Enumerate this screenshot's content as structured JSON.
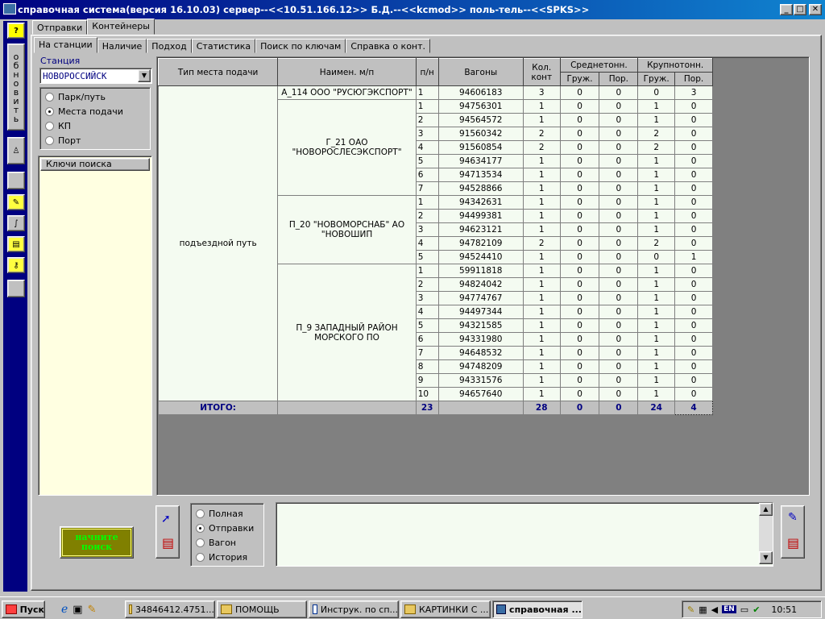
{
  "window": {
    "title": "справочная система(версия 16.10.03) сервер--<<10.51.166.12>> Б.Д.--<<kcmod>> поль-тель--<<SPKS>>"
  },
  "left_toolbar": {
    "refresh_label": "обновить",
    "help_label": "?"
  },
  "top_tabs": [
    "Отправки",
    "Контейнеры"
  ],
  "sub_tabs": [
    "На станции",
    "Наличие",
    "Подход",
    "Статистика",
    "Поиск по ключам",
    "Справка о конт."
  ],
  "station": {
    "label": "Станция",
    "value": "НОВОРОССИЙСК"
  },
  "mode_radios": [
    {
      "label": "Парк/путь",
      "selected": false
    },
    {
      "label": "Места подачи",
      "selected": true
    },
    {
      "label": "КП",
      "selected": false
    },
    {
      "label": "Порт",
      "selected": false
    }
  ],
  "keys_panel": {
    "header": "Ключи поиска"
  },
  "table": {
    "headers": {
      "type": "Тип места подачи",
      "name": "Наимен. м/п",
      "pn": "п/н",
      "wagons": "Вагоны",
      "kolkont": "Кол. конт",
      "medium": "Среднетонн.",
      "large": "Крупнотонн.",
      "gruzh": "Груж.",
      "por": "Пор."
    },
    "type_value": "подъездной путь",
    "groups": [
      {
        "name": "А_114 ООО \"РУСЮГЭКСПОРТ\"",
        "rows": [
          [
            "1",
            "94606183",
            "3",
            "0",
            "0",
            "0",
            "3"
          ]
        ]
      },
      {
        "name": "Г_21 ОАО \"НОВОРОСЛЕСЭКСПОРТ\"",
        "rows": [
          [
            "1",
            "94756301",
            "1",
            "0",
            "0",
            "1",
            "0"
          ],
          [
            "2",
            "94564572",
            "1",
            "0",
            "0",
            "1",
            "0"
          ],
          [
            "3",
            "91560342",
            "2",
            "0",
            "0",
            "2",
            "0"
          ],
          [
            "4",
            "91560854",
            "2",
            "0",
            "0",
            "2",
            "0"
          ],
          [
            "5",
            "94634177",
            "1",
            "0",
            "0",
            "1",
            "0"
          ],
          [
            "6",
            "94713534",
            "1",
            "0",
            "0",
            "1",
            "0"
          ],
          [
            "7",
            "94528866",
            "1",
            "0",
            "0",
            "1",
            "0"
          ]
        ]
      },
      {
        "name": "П_20 \"НОВОМОРСНАБ\" АО \"НОВОШИП",
        "rows": [
          [
            "1",
            "94342631",
            "1",
            "0",
            "0",
            "1",
            "0"
          ],
          [
            "2",
            "94499381",
            "1",
            "0",
            "0",
            "1",
            "0"
          ],
          [
            "3",
            "94623121",
            "1",
            "0",
            "0",
            "1",
            "0"
          ],
          [
            "4",
            "94782109",
            "2",
            "0",
            "0",
            "2",
            "0"
          ],
          [
            "5",
            "94524410",
            "1",
            "0",
            "0",
            "0",
            "1"
          ]
        ]
      },
      {
        "name": "П_9 ЗАПАДНЫЙ РАЙОН МОРСКОГО ПО",
        "rows": [
          [
            "1",
            "59911818",
            "1",
            "0",
            "0",
            "1",
            "0"
          ],
          [
            "2",
            "94824042",
            "1",
            "0",
            "0",
            "1",
            "0"
          ],
          [
            "3",
            "94774767",
            "1",
            "0",
            "0",
            "1",
            "0"
          ],
          [
            "4",
            "94497344",
            "1",
            "0",
            "0",
            "1",
            "0"
          ],
          [
            "5",
            "94321585",
            "1",
            "0",
            "0",
            "1",
            "0"
          ],
          [
            "6",
            "94331980",
            "1",
            "0",
            "0",
            "1",
            "0"
          ],
          [
            "7",
            "94648532",
            "1",
            "0",
            "0",
            "1",
            "0"
          ],
          [
            "8",
            "94748209",
            "1",
            "0",
            "0",
            "1",
            "0"
          ],
          [
            "9",
            "94331576",
            "1",
            "0",
            "0",
            "1",
            "0"
          ],
          [
            "10",
            "94657640",
            "1",
            "0",
            "0",
            "1",
            "0"
          ]
        ]
      }
    ],
    "total": {
      "label": "ИТОГО:",
      "pn": "23",
      "kolkont": "28",
      "m_gr": "0",
      "m_por": "0",
      "l_gr": "24",
      "l_por": "4"
    }
  },
  "search_button": {
    "label": "начните поиск"
  },
  "output_radios": [
    {
      "label": "Полная",
      "selected": false
    },
    {
      "label": "Отправки",
      "selected": true
    },
    {
      "label": "Вагон",
      "selected": false
    },
    {
      "label": "История",
      "selected": false
    }
  ],
  "taskbar": {
    "start": "Пуск",
    "items": [
      "34846412.4751...",
      "ПОМОЩЬ",
      "Инструк. по сп...",
      "КАРТИНКИ С ...",
      "справочная ..."
    ],
    "lang": "EN",
    "clock": "10:51"
  },
  "colors": {
    "title_start": "#000080",
    "title_end": "#1084d0",
    "panel_bg": "#ffffe1",
    "cell_bg": "#f4fbf1",
    "search_btn": "#808000",
    "search_text": "#00ff00"
  }
}
